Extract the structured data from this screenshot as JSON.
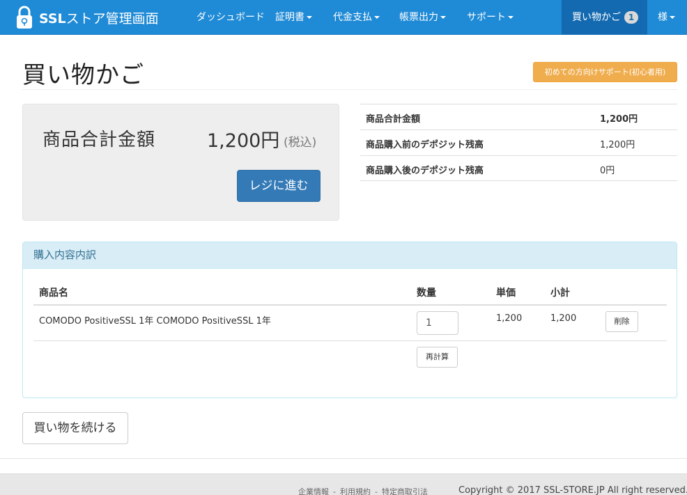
{
  "navbar": {
    "brand_bold": "SSL",
    "brand_rest": "ストア管理画面",
    "items": [
      {
        "label": "ダッシュボード"
      },
      {
        "label": "証明書"
      },
      {
        "label": "代金支払"
      },
      {
        "label": "帳票出力"
      },
      {
        "label": "サポート"
      }
    ],
    "cart_label": "買い物かご",
    "cart_count": "1",
    "user_label": "様"
  },
  "header": {
    "title": "買い物かご",
    "help_button": "初めての方向けサポート(初心者用)"
  },
  "total": {
    "label": "商品合計金額",
    "amount": "1,200円",
    "tax_note": "(税込)",
    "checkout_button": "レジに進む"
  },
  "summary": {
    "rows": [
      {
        "label": "商品合計金額",
        "value": "1,200円"
      },
      {
        "label": "商品購入前のデポジット残高",
        "value": "1,200円"
      },
      {
        "label": "商品購入後のデポジット残高",
        "value": "0円"
      }
    ]
  },
  "order": {
    "heading": "購入内容内訳",
    "columns": {
      "name": "商品名",
      "qty": "数量",
      "unit_price": "単価",
      "subtotal": "小計"
    },
    "items": [
      {
        "name": "COMODO PositiveSSL 1年 COMODO PositiveSSL 1年",
        "qty": "1",
        "unit_price": "1,200",
        "subtotal": "1,200",
        "delete_label": "削除"
      }
    ],
    "recalc_button": "再計算"
  },
  "continue_button": "買い物を続ける",
  "footer": {
    "links": [
      "企業情報",
      "利用規約",
      "特定商取引法"
    ],
    "separator": "-",
    "copyright": "Copyright © 2017 SSL-STORE.JP All right reserved."
  },
  "colors": {
    "navbar": "#1f8ad6",
    "navbar_active": "#146ab0",
    "primary": "#337ab7",
    "warning": "#f0ad4e",
    "panel_info": "#d9edf7"
  }
}
